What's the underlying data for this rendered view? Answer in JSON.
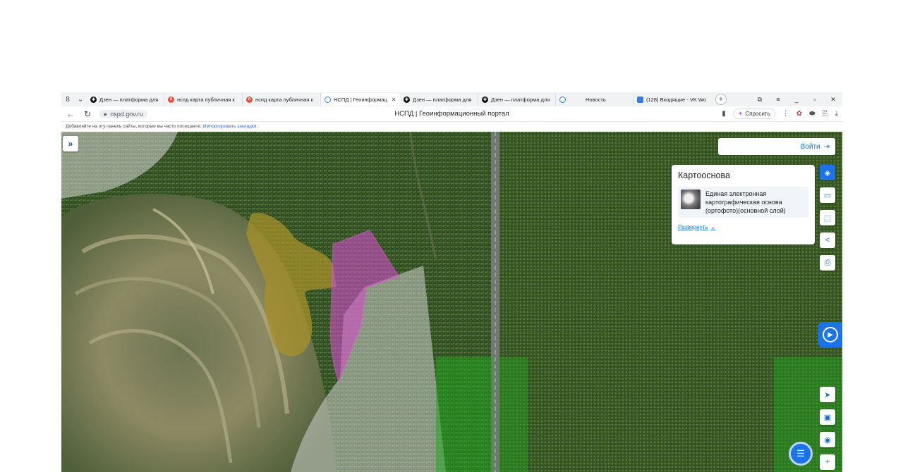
{
  "browser": {
    "tabs": [
      {
        "label": "Дзен — платформа для",
        "icon": "dzen-icon"
      },
      {
        "label": "нспд карта публичная к",
        "icon": "yandex-icon"
      },
      {
        "label": "нспд карта публичная к",
        "icon": "yandex-icon"
      },
      {
        "label": "НСПД | Геоинформац",
        "icon": "nspd-icon",
        "active": true
      },
      {
        "label": "Дзен — платформа для",
        "icon": "dzen-icon"
      },
      {
        "label": "Дзен — платформа для",
        "icon": "dzen-icon"
      },
      {
        "label": "Новость",
        "icon": "news-icon"
      },
      {
        "label": "(128) Входящие - VK Wo",
        "icon": "vk-mail-icon"
      }
    ],
    "counter": "8",
    "url": "nspd.gov.ru",
    "page_title": "НСПД | Геоинформационный портал",
    "ask_label": "Спросить",
    "bookmarks_text": "Добавляйте на эту панель сайты, которые вы часто посещаете.",
    "bookmarks_link": "Импортировать закладки"
  },
  "map": {
    "login_label": "Войти",
    "layer_panel": {
      "title": "Картооснова",
      "layer_name": "Единая электронная картографическая основа (ортофото)(основной слой)",
      "expand_label": "Развернуть"
    }
  },
  "colors": {
    "accent": "#1a73e8",
    "polygon_magenta": "#d04cc8",
    "polygon_ochre": "#a7902a",
    "polygon_light": "#dcdcdc",
    "zone_green": "#1fa81f"
  }
}
